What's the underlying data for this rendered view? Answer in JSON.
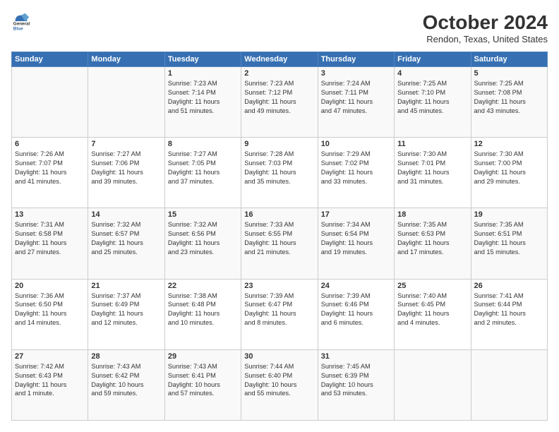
{
  "header": {
    "logo_line1": "General",
    "logo_line2": "Blue",
    "title": "October 2024",
    "location": "Rendon, Texas, United States"
  },
  "weekdays": [
    "Sunday",
    "Monday",
    "Tuesday",
    "Wednesday",
    "Thursday",
    "Friday",
    "Saturday"
  ],
  "weeks": [
    [
      {
        "day": "",
        "info": ""
      },
      {
        "day": "",
        "info": ""
      },
      {
        "day": "1",
        "info": "Sunrise: 7:23 AM\nSunset: 7:14 PM\nDaylight: 11 hours\nand 51 minutes."
      },
      {
        "day": "2",
        "info": "Sunrise: 7:23 AM\nSunset: 7:12 PM\nDaylight: 11 hours\nand 49 minutes."
      },
      {
        "day": "3",
        "info": "Sunrise: 7:24 AM\nSunset: 7:11 PM\nDaylight: 11 hours\nand 47 minutes."
      },
      {
        "day": "4",
        "info": "Sunrise: 7:25 AM\nSunset: 7:10 PM\nDaylight: 11 hours\nand 45 minutes."
      },
      {
        "day": "5",
        "info": "Sunrise: 7:25 AM\nSunset: 7:08 PM\nDaylight: 11 hours\nand 43 minutes."
      }
    ],
    [
      {
        "day": "6",
        "info": "Sunrise: 7:26 AM\nSunset: 7:07 PM\nDaylight: 11 hours\nand 41 minutes."
      },
      {
        "day": "7",
        "info": "Sunrise: 7:27 AM\nSunset: 7:06 PM\nDaylight: 11 hours\nand 39 minutes."
      },
      {
        "day": "8",
        "info": "Sunrise: 7:27 AM\nSunset: 7:05 PM\nDaylight: 11 hours\nand 37 minutes."
      },
      {
        "day": "9",
        "info": "Sunrise: 7:28 AM\nSunset: 7:03 PM\nDaylight: 11 hours\nand 35 minutes."
      },
      {
        "day": "10",
        "info": "Sunrise: 7:29 AM\nSunset: 7:02 PM\nDaylight: 11 hours\nand 33 minutes."
      },
      {
        "day": "11",
        "info": "Sunrise: 7:30 AM\nSunset: 7:01 PM\nDaylight: 11 hours\nand 31 minutes."
      },
      {
        "day": "12",
        "info": "Sunrise: 7:30 AM\nSunset: 7:00 PM\nDaylight: 11 hours\nand 29 minutes."
      }
    ],
    [
      {
        "day": "13",
        "info": "Sunrise: 7:31 AM\nSunset: 6:58 PM\nDaylight: 11 hours\nand 27 minutes."
      },
      {
        "day": "14",
        "info": "Sunrise: 7:32 AM\nSunset: 6:57 PM\nDaylight: 11 hours\nand 25 minutes."
      },
      {
        "day": "15",
        "info": "Sunrise: 7:32 AM\nSunset: 6:56 PM\nDaylight: 11 hours\nand 23 minutes."
      },
      {
        "day": "16",
        "info": "Sunrise: 7:33 AM\nSunset: 6:55 PM\nDaylight: 11 hours\nand 21 minutes."
      },
      {
        "day": "17",
        "info": "Sunrise: 7:34 AM\nSunset: 6:54 PM\nDaylight: 11 hours\nand 19 minutes."
      },
      {
        "day": "18",
        "info": "Sunrise: 7:35 AM\nSunset: 6:53 PM\nDaylight: 11 hours\nand 17 minutes."
      },
      {
        "day": "19",
        "info": "Sunrise: 7:35 AM\nSunset: 6:51 PM\nDaylight: 11 hours\nand 15 minutes."
      }
    ],
    [
      {
        "day": "20",
        "info": "Sunrise: 7:36 AM\nSunset: 6:50 PM\nDaylight: 11 hours\nand 14 minutes."
      },
      {
        "day": "21",
        "info": "Sunrise: 7:37 AM\nSunset: 6:49 PM\nDaylight: 11 hours\nand 12 minutes."
      },
      {
        "day": "22",
        "info": "Sunrise: 7:38 AM\nSunset: 6:48 PM\nDaylight: 11 hours\nand 10 minutes."
      },
      {
        "day": "23",
        "info": "Sunrise: 7:39 AM\nSunset: 6:47 PM\nDaylight: 11 hours\nand 8 minutes."
      },
      {
        "day": "24",
        "info": "Sunrise: 7:39 AM\nSunset: 6:46 PM\nDaylight: 11 hours\nand 6 minutes."
      },
      {
        "day": "25",
        "info": "Sunrise: 7:40 AM\nSunset: 6:45 PM\nDaylight: 11 hours\nand 4 minutes."
      },
      {
        "day": "26",
        "info": "Sunrise: 7:41 AM\nSunset: 6:44 PM\nDaylight: 11 hours\nand 2 minutes."
      }
    ],
    [
      {
        "day": "27",
        "info": "Sunrise: 7:42 AM\nSunset: 6:43 PM\nDaylight: 11 hours\nand 1 minute."
      },
      {
        "day": "28",
        "info": "Sunrise: 7:43 AM\nSunset: 6:42 PM\nDaylight: 10 hours\nand 59 minutes."
      },
      {
        "day": "29",
        "info": "Sunrise: 7:43 AM\nSunset: 6:41 PM\nDaylight: 10 hours\nand 57 minutes."
      },
      {
        "day": "30",
        "info": "Sunrise: 7:44 AM\nSunset: 6:40 PM\nDaylight: 10 hours\nand 55 minutes."
      },
      {
        "day": "31",
        "info": "Sunrise: 7:45 AM\nSunset: 6:39 PM\nDaylight: 10 hours\nand 53 minutes."
      },
      {
        "day": "",
        "info": ""
      },
      {
        "day": "",
        "info": ""
      }
    ]
  ]
}
